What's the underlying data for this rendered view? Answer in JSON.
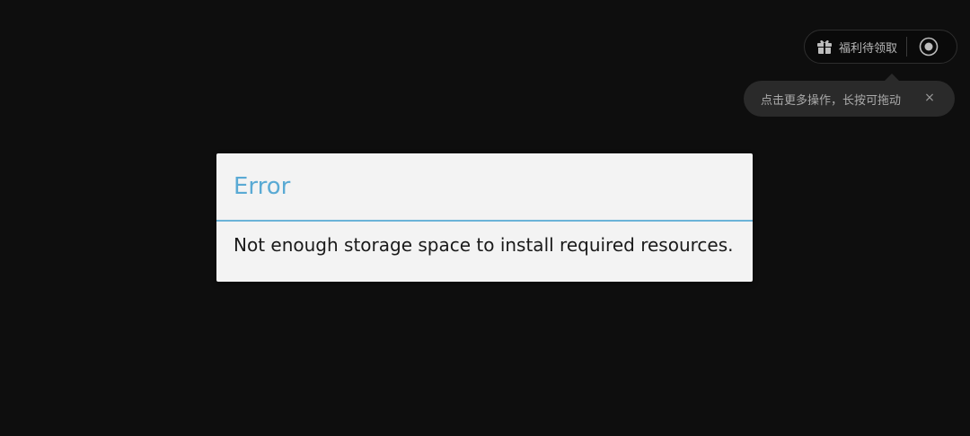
{
  "floating_widget": {
    "gift_icon": "gift-icon",
    "label": "福利待领取",
    "target_icon": "target-circle-icon"
  },
  "tooltip": {
    "text": "点击更多操作，长按可拖动",
    "close_label": "×"
  },
  "dialog": {
    "title": "Error",
    "message": "Not enough storage space to install required resources.",
    "accent_color": "#5aaad4"
  }
}
